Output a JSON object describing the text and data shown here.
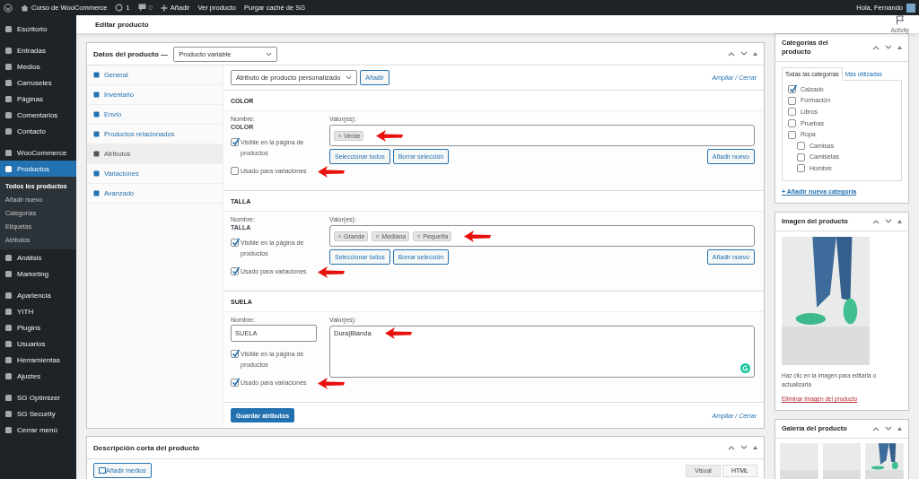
{
  "admin_bar": {
    "site": "Curso de WooCommerce",
    "updates": "1",
    "comments": "0",
    "items": [
      "Añadir",
      "Ver producto",
      "Purgar caché de SG"
    ],
    "greeting": "Hola, Fernando"
  },
  "sidebar": {
    "groups": [
      [
        {
          "label": "Escritorio",
          "selected": false
        }
      ],
      [
        {
          "label": "Entradas",
          "selected": false
        },
        {
          "label": "Medios",
          "selected": false
        },
        {
          "label": "Carruseles",
          "selected": false
        },
        {
          "label": "Páginas",
          "selected": false
        },
        {
          "label": "Comentarios",
          "selected": false
        },
        {
          "label": "Contacto",
          "selected": false
        }
      ],
      [
        {
          "label": "WooCommerce",
          "selected": false
        },
        {
          "label": "Productos",
          "selected": true,
          "children": [
            {
              "label": "Todos los productos",
              "selected": true
            },
            {
              "label": "Añadir nuevo",
              "selected": false
            },
            {
              "label": "Categorías",
              "selected": false
            },
            {
              "label": "Etiquetas",
              "selected": false
            },
            {
              "label": "Atributos",
              "selected": false
            }
          ]
        },
        {
          "label": "Análisis",
          "selected": false
        },
        {
          "label": "Marketing",
          "selected": false
        }
      ],
      [
        {
          "label": "Apariencia",
          "selected": false
        },
        {
          "label": "YITH",
          "selected": false
        },
        {
          "label": "Plugins",
          "selected": false
        },
        {
          "label": "Usuarios",
          "selected": false
        },
        {
          "label": "Herramientas",
          "selected": false
        },
        {
          "label": "Ajustes",
          "selected": false
        }
      ],
      [
        {
          "label": "SG Optimizer",
          "selected": false
        },
        {
          "label": "SG Security",
          "selected": false
        },
        {
          "label": "Cerrar menú",
          "selected": false
        }
      ]
    ]
  },
  "header": {
    "title": "Editar producto",
    "activity": "Activity"
  },
  "product_data": {
    "title": "Datos del producto —",
    "type": "Producto variable",
    "tabs": [
      {
        "label": "General",
        "selected": false
      },
      {
        "label": "Inventario",
        "selected": false
      },
      {
        "label": "Envío",
        "selected": false
      },
      {
        "label": "Productos relacionados",
        "selected": false
      },
      {
        "label": "Atributos",
        "selected": true
      },
      {
        "label": "Variaciones",
        "selected": false
      },
      {
        "label": "Avanzado",
        "selected": false
      }
    ],
    "attribute_select": "Atributo de producto personalizado",
    "add_button": "Añadir",
    "expand_link": "Ampliar / Cerrar",
    "attributes": [
      {
        "kind": "taxonomy",
        "title": "COLOR",
        "name_label": "Nombre:",
        "name": "COLOR",
        "values_label": "Valor(es):",
        "values": [
          "Verde"
        ],
        "values_marked": true,
        "visible_label": "Visible en la página de productos",
        "visible": true,
        "variation_label": "Usado para variaciones",
        "variation": false,
        "variation_marked": true,
        "select_all": "Seleccionar todos",
        "clear": "Borrar selección",
        "add_new": "Añadir nuevo"
      },
      {
        "kind": "taxonomy",
        "title": "TALLA",
        "name_label": "Nombre:",
        "name": "TALLA",
        "values_label": "Valor(es):",
        "values": [
          "Grande",
          "Mediana",
          "Pequeña"
        ],
        "values_marked": true,
        "visible_label": "Visible en la página de productos",
        "visible": true,
        "variation_label": "Usado para variaciones",
        "variation": true,
        "variation_marked": true,
        "select_all": "Seleccionar todos",
        "clear": "Borrar selección",
        "add_new": "Añadir nuevo"
      },
      {
        "kind": "custom",
        "title": "SUELA",
        "name_label": "Nombre:",
        "name": "SUELA",
        "values_label": "Valor(es):",
        "value_text": "Dura|Blanda",
        "values_marked": true,
        "visible_label": "Visible en la página de productos",
        "visible": true,
        "variation_label": "Usado para variaciones",
        "variation": true,
        "variation_marked": true
      }
    ],
    "save_button": "Guardar atributos",
    "footer_link": "Ampliar / Cerrar"
  },
  "short_description": {
    "title": "Descripción corta del producto",
    "media_button": "Añadir medios",
    "tabs": [
      {
        "label": "Visual",
        "selected": false
      },
      {
        "label": "HTML",
        "selected": true
      }
    ]
  },
  "categories": {
    "title": "Categorías del producto",
    "tabs": [
      {
        "label": "Todas las categorías",
        "selected": true
      },
      {
        "label": "Más utilizadas",
        "selected": false
      }
    ],
    "items": [
      {
        "label": "Calzado",
        "checked": true
      },
      {
        "label": "Formación",
        "checked": false
      },
      {
        "label": "Libros",
        "checked": false
      },
      {
        "label": "Pruebas",
        "checked": false
      },
      {
        "label": "Ropa",
        "checked": false,
        "children": [
          {
            "label": "Camisas",
            "checked": false
          },
          {
            "label": "Camisetas",
            "checked": false
          },
          {
            "label": "Hombre",
            "checked": false
          }
        ]
      }
    ],
    "add_link": "+ Añadir nueva categoría"
  },
  "product_image": {
    "title": "Imagen del producto",
    "hint": "Haz clic en la imagen para editarla o actualizarla",
    "remove_link": "Eliminar imagen del producto"
  },
  "gallery": {
    "title": "Galería del producto"
  }
}
